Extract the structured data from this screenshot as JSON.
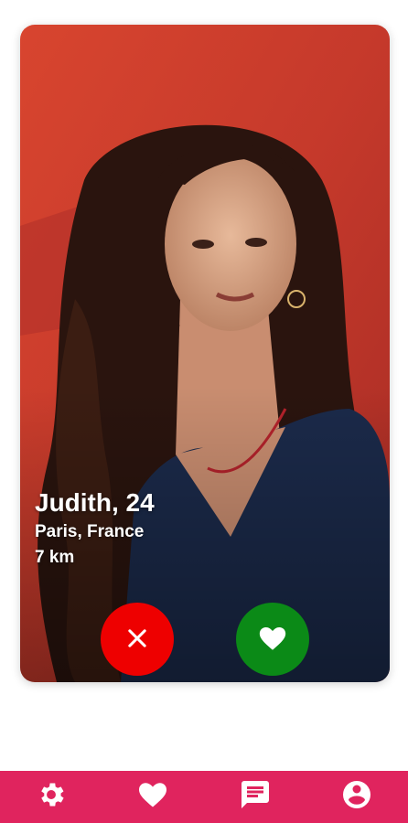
{
  "profile": {
    "name_age": "Judith, 24",
    "location": "Paris, France",
    "distance": "7 km"
  },
  "actions": {
    "dislike_icon": "close-icon",
    "like_icon": "heart-icon"
  },
  "bottom_nav": {
    "items": [
      {
        "icon": "gear-icon"
      },
      {
        "icon": "heart-icon"
      },
      {
        "icon": "chat-icon"
      },
      {
        "icon": "account-icon"
      }
    ]
  },
  "colors": {
    "nav_background": "#e0245e",
    "dislike_button": "#ee0000",
    "like_button": "#0b8a17",
    "photo_wall": "#c93a2c",
    "shirt": "#1b2a4a"
  }
}
